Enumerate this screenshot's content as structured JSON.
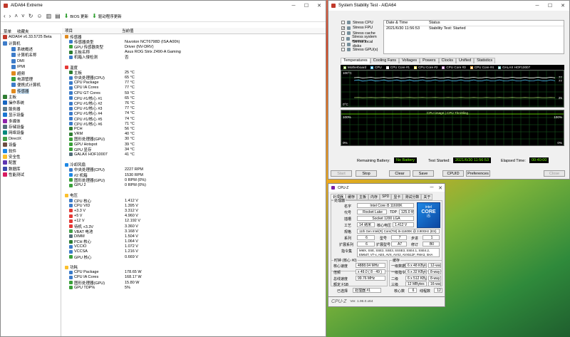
{
  "aida": {
    "title": "AIDA64 Extreme",
    "toolbar": {
      "report": "",
      "bios": "BIOS 更新",
      "driver": "驱动程序更新"
    },
    "tabs": [
      "菜单",
      "收藏夹"
    ],
    "col_field": "项目",
    "col_value": "当前值",
    "tree": [
      {
        "label": "AIDA64 v6.33.5725 Beta",
        "lvl": 0,
        "color": "#c0392b"
      },
      {
        "label": "计算机",
        "lvl": 0,
        "color": "#3d7cc9"
      },
      {
        "label": "系统概述",
        "lvl": 1,
        "color": "#3d7cc9"
      },
      {
        "label": "计算机名称",
        "lvl": 1,
        "color": "#3d7cc9"
      },
      {
        "label": "DMI",
        "lvl": 1,
        "color": "#3d7cc9"
      },
      {
        "label": "IPMI",
        "lvl": 1,
        "color": "#3d7cc9"
      },
      {
        "label": "超频",
        "lvl": 1,
        "color": "#e08a1e"
      },
      {
        "label": "电源管理",
        "lvl": 1,
        "color": "#3aa03a"
      },
      {
        "label": "便携式计算机",
        "lvl": 1,
        "color": "#3d7cc9"
      },
      {
        "label": "传感器",
        "lvl": 1,
        "color": "#e08a1e"
      },
      {
        "label": "主板",
        "lvl": 0,
        "color": "#2e7d32"
      },
      {
        "label": "操作系统",
        "lvl": 0,
        "color": "#1565c0"
      },
      {
        "label": "服务器",
        "lvl": 0,
        "color": "#607d8b"
      },
      {
        "label": "显示设备",
        "lvl": 0,
        "color": "#1976d2"
      },
      {
        "label": "多媒体",
        "lvl": 0,
        "color": "#8e24aa"
      },
      {
        "label": "存储设备",
        "lvl": 0,
        "color": "#546e7a"
      },
      {
        "label": "网络设备",
        "lvl": 0,
        "color": "#00897b"
      },
      {
        "label": "DirectX",
        "lvl": 0,
        "color": "#43a047"
      },
      {
        "label": "设备",
        "lvl": 0,
        "color": "#6d4c41"
      },
      {
        "label": "软件",
        "lvl": 0,
        "color": "#1e88e5"
      },
      {
        "label": "安全性",
        "lvl": 0,
        "color": "#fbc02d"
      },
      {
        "label": "配置",
        "lvl": 0,
        "color": "#5e35b1"
      },
      {
        "label": "数据库",
        "lvl": 0,
        "color": "#3949ab"
      },
      {
        "label": "性能测试",
        "lvl": 0,
        "color": "#d81b60"
      }
    ],
    "rows": [
      {
        "f": "传感器",
        "v": "",
        "sec": true,
        "c": "#e08a1e"
      },
      {
        "f": "传感器类型",
        "v": "Nuvoton NCT6798D (ISA A00h)",
        "c": "#3d7cc9"
      },
      {
        "f": "GPU 传感器类型",
        "v": "Driver (NV-DRV)",
        "c": "#3aa03a"
      },
      {
        "f": "主板名称",
        "v": "Asus ROG Strix Z490-A Gaming",
        "c": "#2e7d32"
      },
      {
        "f": "机箱入侵检测",
        "v": "否",
        "c": "#3d7cc9"
      },
      {
        "f": "",
        "v": ""
      },
      {
        "f": "温度",
        "v": "",
        "sec": true,
        "c": "#e53935"
      },
      {
        "f": "主板",
        "v": "25 °C",
        "c": "#2e7d32"
      },
      {
        "f": "中央处理器(CPU)",
        "v": "65 °C",
        "c": "#3d7cc9"
      },
      {
        "f": "CPU Package",
        "v": "77 °C",
        "c": "#3d7cc9"
      },
      {
        "f": "CPU IA Cores",
        "v": "77 °C",
        "c": "#3d7cc9"
      },
      {
        "f": "CPU GT Cores",
        "v": "59 °C",
        "c": "#3d7cc9"
      },
      {
        "f": "CPU #1/核心 #1",
        "v": "65 °C",
        "c": "#3d7cc9"
      },
      {
        "f": "CPU #1/核心 #2",
        "v": "76 °C",
        "c": "#3d7cc9"
      },
      {
        "f": "CPU #1/核心 #3",
        "v": "77 °C",
        "c": "#3d7cc9"
      },
      {
        "f": "CPU #1/核心 #4",
        "v": "74 °C",
        "c": "#3d7cc9"
      },
      {
        "f": "CPU #1/核心 #5",
        "v": "74 °C",
        "c": "#3d7cc9"
      },
      {
        "f": "CPU #1/核心 #6",
        "v": "71 °C",
        "c": "#3d7cc9"
      },
      {
        "f": "PCH",
        "v": "56 °C",
        "c": "#2e7d32"
      },
      {
        "f": "VRM",
        "v": "40 °C",
        "c": "#2e7d32"
      },
      {
        "f": "图形处理器(GPU)",
        "v": "30 °C",
        "c": "#3aa03a"
      },
      {
        "f": "GPU Hotspot",
        "v": "39 °C",
        "c": "#3aa03a"
      },
      {
        "f": "GPU 显存",
        "v": "34 °C",
        "c": "#3aa03a"
      },
      {
        "f": "GALAX HOF10007",
        "v": "41 °C",
        "c": "#546e7a"
      },
      {
        "f": "",
        "v": ""
      },
      {
        "f": "冷却风扇",
        "v": "",
        "sec": true,
        "c": "#1e88e5"
      },
      {
        "f": "中央处理器(CPU)",
        "v": "2227 RPM",
        "c": "#3d7cc9"
      },
      {
        "f": "#2 机箱",
        "v": "1530 RPM",
        "c": "#1e88e5"
      },
      {
        "f": "图形处理器(GPU)",
        "v": "0 RPM  (0%)",
        "c": "#3aa03a"
      },
      {
        "f": "GPU 2",
        "v": "0 RPM  (0%)",
        "c": "#3aa03a"
      },
      {
        "f": "",
        "v": ""
      },
      {
        "f": "电压",
        "v": "",
        "sec": true,
        "c": "#fbc02d"
      },
      {
        "f": "CPU 核心",
        "v": "1.412 V",
        "c": "#3d7cc9"
      },
      {
        "f": "CPU VID",
        "v": "1.395 V",
        "c": "#3d7cc9"
      },
      {
        "f": "+3.3 V",
        "v": "3.312 V",
        "c": "#e53935"
      },
      {
        "f": "+5 V",
        "v": "4.960 V",
        "c": "#e53935"
      },
      {
        "f": "+12 V",
        "v": "12.192 V",
        "c": "#e53935"
      },
      {
        "f": "待机 +3.3V",
        "v": "3.360 V",
        "c": "#e53935"
      },
      {
        "f": "VBAT 电池",
        "v": "3.168 V",
        "c": "#43a047"
      },
      {
        "f": "DIMM",
        "v": "1.504 V",
        "c": "#546e7a"
      },
      {
        "f": "PCH 核心",
        "v": "1.064 V",
        "c": "#2e7d32"
      },
      {
        "f": "VCCIO",
        "v": "1.072 V",
        "c": "#3d7cc9"
      },
      {
        "f": "VCCSA",
        "v": "1.216 V",
        "c": "#3d7cc9"
      },
      {
        "f": "GPU 核心",
        "v": "0.669 V",
        "c": "#3aa03a"
      },
      {
        "f": "",
        "v": ""
      },
      {
        "f": "功耗",
        "v": "",
        "sec": true,
        "c": "#fbc02d"
      },
      {
        "f": "CPU Package",
        "v": "178.65 W",
        "c": "#3d7cc9"
      },
      {
        "f": "CPU IA Cores",
        "v": "168.17 W",
        "c": "#3d7cc9"
      },
      {
        "f": "图形处理器(GPU)",
        "v": "15.80 W",
        "c": "#3aa03a"
      },
      {
        "f": "GPU TDP%",
        "v": "5%",
        "c": "#3aa03a"
      }
    ]
  },
  "sst": {
    "title": "System Stability Test - AIDA64",
    "checks": [
      {
        "label": "Stress CPU",
        "on": false
      },
      {
        "label": "Stress FPU",
        "on": true
      },
      {
        "label": "Stress cache",
        "on": false
      },
      {
        "label": "Stress system memory",
        "on": false
      },
      {
        "label": "Stress local disks",
        "on": false
      },
      {
        "label": "Stress GPU(s)",
        "on": false
      }
    ],
    "status_head": [
      "Date & Time",
      "Status"
    ],
    "status_row": [
      "2021/6/30 11:56:53",
      "Stability Test: Started"
    ],
    "tabs": [
      "Temperatures",
      "Cooling Fans",
      "Voltages",
      "Powers",
      "Clocks",
      "Unified",
      "Statistics"
    ],
    "legend": [
      "Motherboard",
      "CPU",
      "CPU Core #1",
      "CPU Core #2",
      "CPU Core #3",
      "CPU Core #4",
      "GALAX HOF10007"
    ],
    "g1_top": "100°C",
    "g1_bot": "0°C",
    "g1_vals": [
      "77",
      "77",
      "25"
    ],
    "g2_legend": "CPU Usage  |  CPU Throttling",
    "g2_top": "100%",
    "g2_bot": "0%",
    "g2_right_top": "100%",
    "g2_right_bot": "0%",
    "battery_label": "Remaining Battery:",
    "battery": "No Battery",
    "started_label": "Test Started:",
    "started": "2021/6/30 11:56:53",
    "elapsed_label": "Elapsed Time:",
    "elapsed": "00:40:00",
    "buttons": [
      "Start",
      "Stop",
      "Clear",
      "Save",
      "CPUID",
      "Preferences",
      "Close"
    ]
  },
  "cpuz": {
    "title": "CPU-Z",
    "tabs": [
      "处理器",
      "缓存",
      "主板",
      "内存",
      "SPD",
      "显卡",
      "测试分数",
      "关于"
    ],
    "group_proc": "处理器",
    "name_lbl": "名字",
    "name": "Intel Core i5 11600K",
    "code_lbl": "代号",
    "code": "Rocket Lake",
    "tdp_lbl": "TDP",
    "tdp": "125.0 W",
    "pkg_lbl": "插槽",
    "pkg": "Socket 1200 LGA",
    "tech_lbl": "工艺",
    "tech": "14 纳米",
    "volt_lbl": "核心电压",
    "volt": "1.412 V",
    "spec_lbl": "规格",
    "spec": "11th Gen Intel(R) Core(TM) i5-11600K @ 3.90GHz (ES)",
    "fam_lbl": "系列",
    "fam": "6",
    "mod_lbl": "型号",
    "mod": "7",
    "step_lbl": "步进",
    "step": "1",
    "xfam_lbl": "扩展系列",
    "xfam": "6",
    "xmod_lbl": "扩展型号",
    "xmod": "A7",
    "rev_lbl": "修订",
    "rev": "B0",
    "inst_lbl": "指令集",
    "inst": "MMX, SSE, SSE2, SSE3, SSSE3, SSE4.1, SSE4.2, EM64T, VT-x, AES, AVX, AVX2, AVX512F, FMA3, SHA",
    "clk_group": "时钟 (核心 #0)",
    "cspeed_lbl": "核心速度",
    "cspeed": "4888.04 MHz",
    "mult_lbl": "倍频",
    "mult": "x 49.0 ( 8 - 49 )",
    "bus_lbl": "总线速度",
    "bus": "99.76 MHz",
    "fsb_lbl": "额定 FSB",
    "fsb": "",
    "cache_group": "缓存",
    "l1d_lbl": "一级数据",
    "l1d": "6 x 48 KBytes",
    "l1d_w": "12-way",
    "l1i_lbl": "一级指令",
    "l1i": "6 x 32 KBytes",
    "l1i_w": "8-way",
    "l2_lbl": "二级",
    "l2": "6 x 512 KBytes",
    "l2_w": "8-way",
    "l3_lbl": "三级",
    "l3": "12 MBytes",
    "l3_w": "16-way",
    "sel_lbl": "已选择",
    "sel": "处理器 #1",
    "cores_lbl": "核心数",
    "cores": "6",
    "threads_lbl": "线程数",
    "threads": "12",
    "footer": "CPU-Z",
    "ver": "Ver. 1.96.0.x64",
    "badge_top": "intel",
    "badge_mid": "CORE",
    "badge_bot": "i5"
  }
}
